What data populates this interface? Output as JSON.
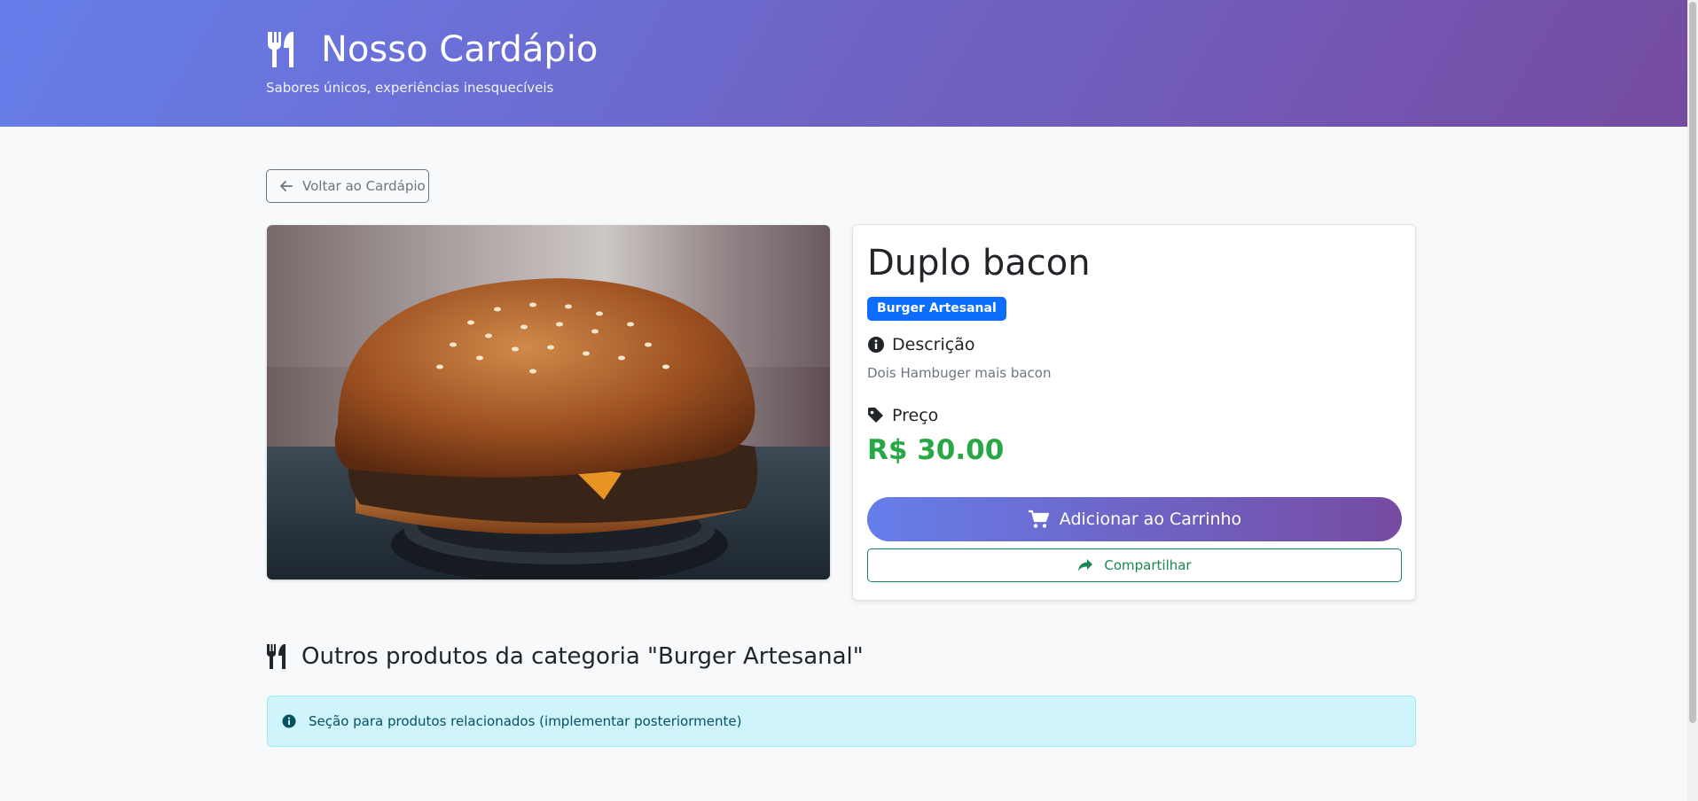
{
  "header": {
    "title": "Nosso Cardápio",
    "tagline": "Sabores únicos, experiências inesquecíveis",
    "icon": "utensils-icon"
  },
  "nav": {
    "back_label": "Voltar ao Cardápio",
    "back_icon": "arrow-left-icon"
  },
  "product": {
    "name": "Duplo bacon",
    "category_badge": "Burger Artesanal",
    "image_alt": "burger",
    "description_heading": "Descrição",
    "description": "Dois Hambuger mais bacon",
    "price_heading": "Preço",
    "price": "R$ 30.00",
    "add_to_cart_label": "Adicionar ao Carrinho",
    "share_label": "Compartilhar"
  },
  "related": {
    "title": "Outros produtos da categoria \"Burger Artesanal\"",
    "notice": "Seção para produtos relacionados (implementar posteriormente)"
  },
  "colors": {
    "header_gradient_start": "#667eea",
    "header_gradient_end": "#764ba2",
    "badge": "#0d6efd",
    "price": "#28a745",
    "share": "#198754",
    "alert_bg": "#cff4fc"
  }
}
